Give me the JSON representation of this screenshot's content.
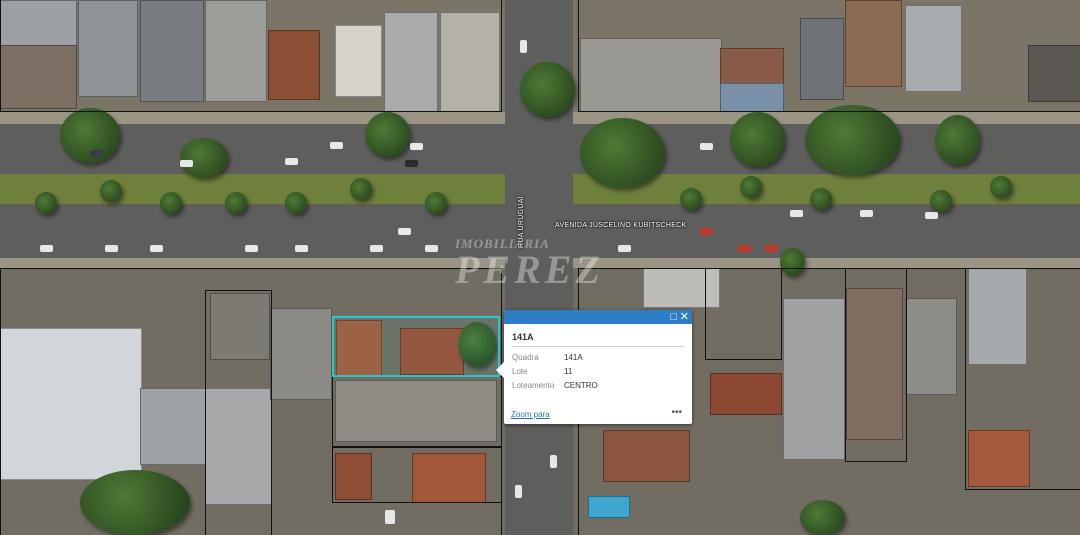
{
  "map": {
    "street_horizontal": "AVENIDA JUSCELINO KUBITSCHECK",
    "street_vertical": "RUA URUGUAI",
    "watermark_top": "IMOBILIÁRIA",
    "watermark_main": "PEREZ"
  },
  "popup": {
    "title": "141A",
    "fields": [
      {
        "label": "Quadra",
        "value": "141A"
      },
      {
        "label": "Lote",
        "value": "11"
      },
      {
        "label": "Loteamento",
        "value": "CENTRO"
      }
    ],
    "zoom_link": "Zoom para",
    "more": "•••",
    "maximize_icon": "□",
    "close_icon": "✕"
  },
  "colors": {
    "popup_header": "#2d7ec4",
    "selection_outline": "#28c6c8",
    "link": "#2a6fc1"
  }
}
